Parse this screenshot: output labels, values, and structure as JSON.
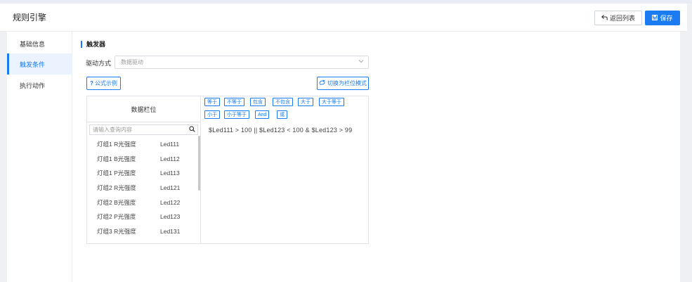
{
  "header": {
    "title": "规则引擎",
    "back_label": "返回列表",
    "save_label": "保存"
  },
  "sidebar": {
    "items": [
      {
        "label": "基础信息"
      },
      {
        "label": "触发条件"
      },
      {
        "label": "执行动作"
      }
    ]
  },
  "trigger": {
    "section_title": "触发器",
    "drive_label": "驱动方式",
    "drive_placeholder": "数据驱动",
    "formula_button": "公式示例",
    "switch_button": "切换为栏位模式"
  },
  "fields": {
    "column_header": "数据栏位",
    "search_placeholder": "请输入查询内容",
    "items": [
      {
        "name": "灯组1 R光强度",
        "code": "Led111"
      },
      {
        "name": "灯组1 B光强度",
        "code": "Led112"
      },
      {
        "name": "灯组1 P光强度",
        "code": "Led113"
      },
      {
        "name": "灯组2 R光强度",
        "code": "Led121"
      },
      {
        "name": "灯组2 B光强度",
        "code": "Led122"
      },
      {
        "name": "灯组2 P光强度",
        "code": "Led123"
      },
      {
        "name": "灯组3 R光强度",
        "code": "Led131"
      }
    ]
  },
  "operators": [
    "等于",
    "不等于",
    "包含",
    "不包含",
    "大于",
    "大于等于",
    "小于",
    "小于等于",
    "And",
    "或"
  ],
  "expression": "$Led111 > 100  ||  $Led123 < 100 & $Led123 > 99",
  "colors": {
    "accent": "#1a7cf0",
    "background": "#eef0f4"
  }
}
